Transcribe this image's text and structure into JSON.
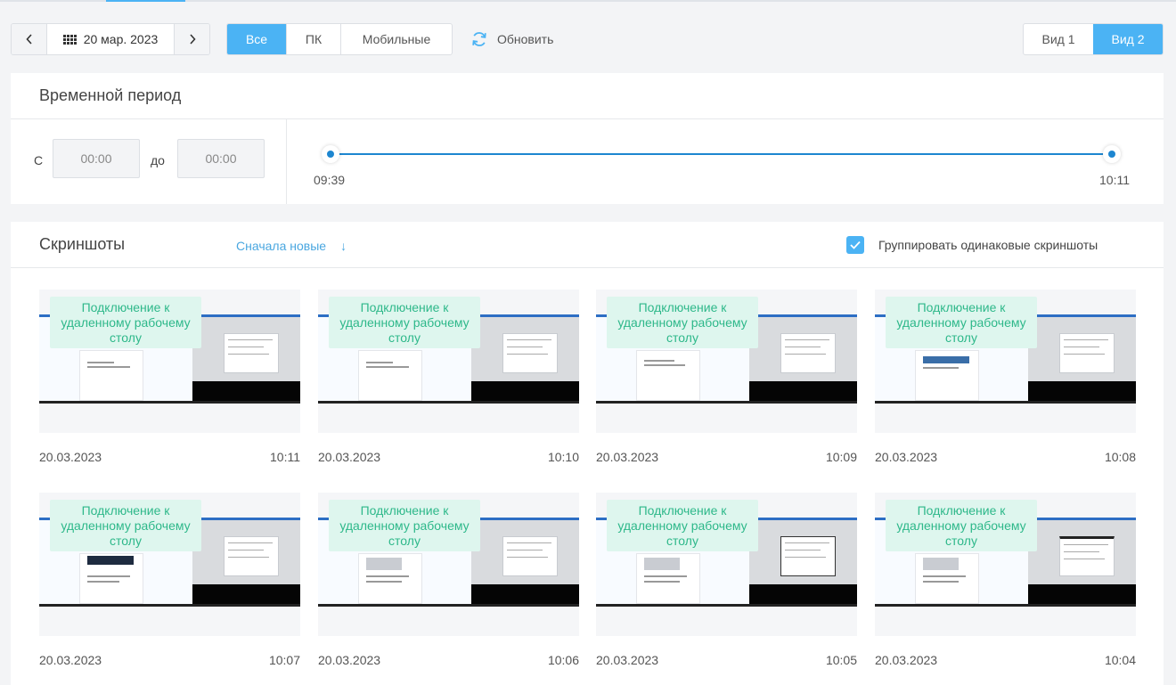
{
  "toolbar": {
    "prev_label": "‹",
    "next_label": "›",
    "date": "20 мар. 2023",
    "filters": [
      {
        "label": "Все",
        "active": true
      },
      {
        "label": "ПК",
        "active": false
      },
      {
        "label": "Мобильные",
        "active": false
      }
    ],
    "refresh_label": "Обновить",
    "views": [
      {
        "label": "Вид 1",
        "active": false
      },
      {
        "label": "Вид 2",
        "active": true
      }
    ]
  },
  "period": {
    "title": "Временной период",
    "from_label": "С",
    "to_label": "до",
    "from_value": "00:00",
    "to_value": "00:00",
    "range_start": "09:39",
    "range_end": "10:11"
  },
  "screenshots": {
    "title": "Скриншоты",
    "sort_label": "Сначала новые",
    "sort_arrow": "↓",
    "group_label": "Группировать одинаковые скриншоты",
    "group_checked": true,
    "badge_text": "Подключение к удаленному рабочему столу",
    "items": [
      {
        "date": "20.03.2023",
        "time": "10:11"
      },
      {
        "date": "20.03.2023",
        "time": "10:10"
      },
      {
        "date": "20.03.2023",
        "time": "10:09"
      },
      {
        "date": "20.03.2023",
        "time": "10:08"
      },
      {
        "date": "20.03.2023",
        "time": "10:07"
      },
      {
        "date": "20.03.2023",
        "time": "10:06"
      },
      {
        "date": "20.03.2023",
        "time": "10:05"
      },
      {
        "date": "20.03.2023",
        "time": "10:04"
      }
    ]
  },
  "colors": {
    "accent": "#4bb3f4",
    "slider": "#1d86d0",
    "badge_bg": "#def6ee",
    "badge_text": "#2eb88a"
  }
}
